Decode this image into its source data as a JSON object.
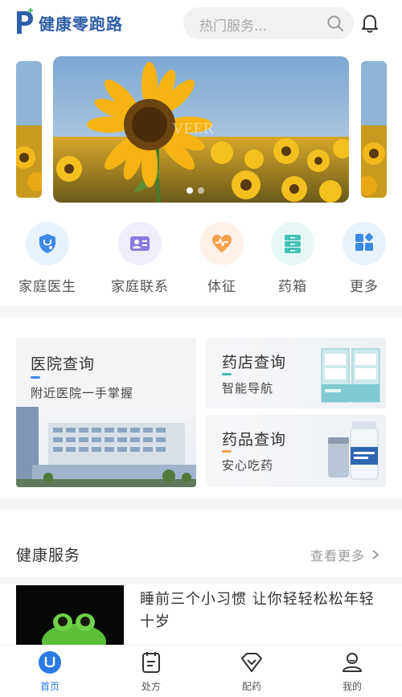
{
  "header": {
    "app_name": "健康零跑路",
    "search_placeholder": "热门服务..."
  },
  "banner": {
    "watermark": "VEER",
    "dots": 2,
    "active_dot": 0
  },
  "quick_menu": [
    {
      "label": "家庭医生",
      "icon": "stethoscope-shield-icon",
      "bg": "#e8f2fd",
      "color": "#3b8ae8"
    },
    {
      "label": "家庭联系",
      "icon": "contact-card-icon",
      "bg": "#efeefd",
      "color": "#8a7ce0"
    },
    {
      "label": "体征",
      "icon": "heart-pulse-icon",
      "bg": "#fff1e8",
      "color": "#f6a24f"
    },
    {
      "label": "药箱",
      "icon": "medicine-cabinet-icon",
      "bg": "#e6f8f6",
      "color": "#46c1b6"
    },
    {
      "label": "更多",
      "icon": "grid-more-icon",
      "bg": "#e8f2fd",
      "color": "#3b8ae8"
    }
  ],
  "cards": {
    "hospital": {
      "title": "医院查询",
      "subtitle": "附近医院一手掌握",
      "bar_color": "#3b8ae8"
    },
    "pharmacy": {
      "title": "药店查询",
      "subtitle": "智能导航",
      "bar_color": "#46c1b6"
    },
    "drug": {
      "title": "药品查询",
      "subtitle": "安心吃药",
      "bar_color": "#f6a24f"
    }
  },
  "services": {
    "title": "健康服务",
    "more": "查看更多",
    "articles": [
      {
        "title": "睡前三个小习惯 让你轻轻松松年轻十岁"
      }
    ]
  },
  "tabbar": [
    {
      "label": "首页",
      "icon": "home-icon",
      "active": true
    },
    {
      "label": "处方",
      "icon": "prescription-icon",
      "active": false
    },
    {
      "label": "配药",
      "icon": "dispense-icon",
      "active": false
    },
    {
      "label": "我的",
      "icon": "profile-icon",
      "active": false
    }
  ],
  "colors": {
    "accent": "#2a7be4",
    "brand": "#2f5fa8",
    "background": "#f4f5f7"
  }
}
